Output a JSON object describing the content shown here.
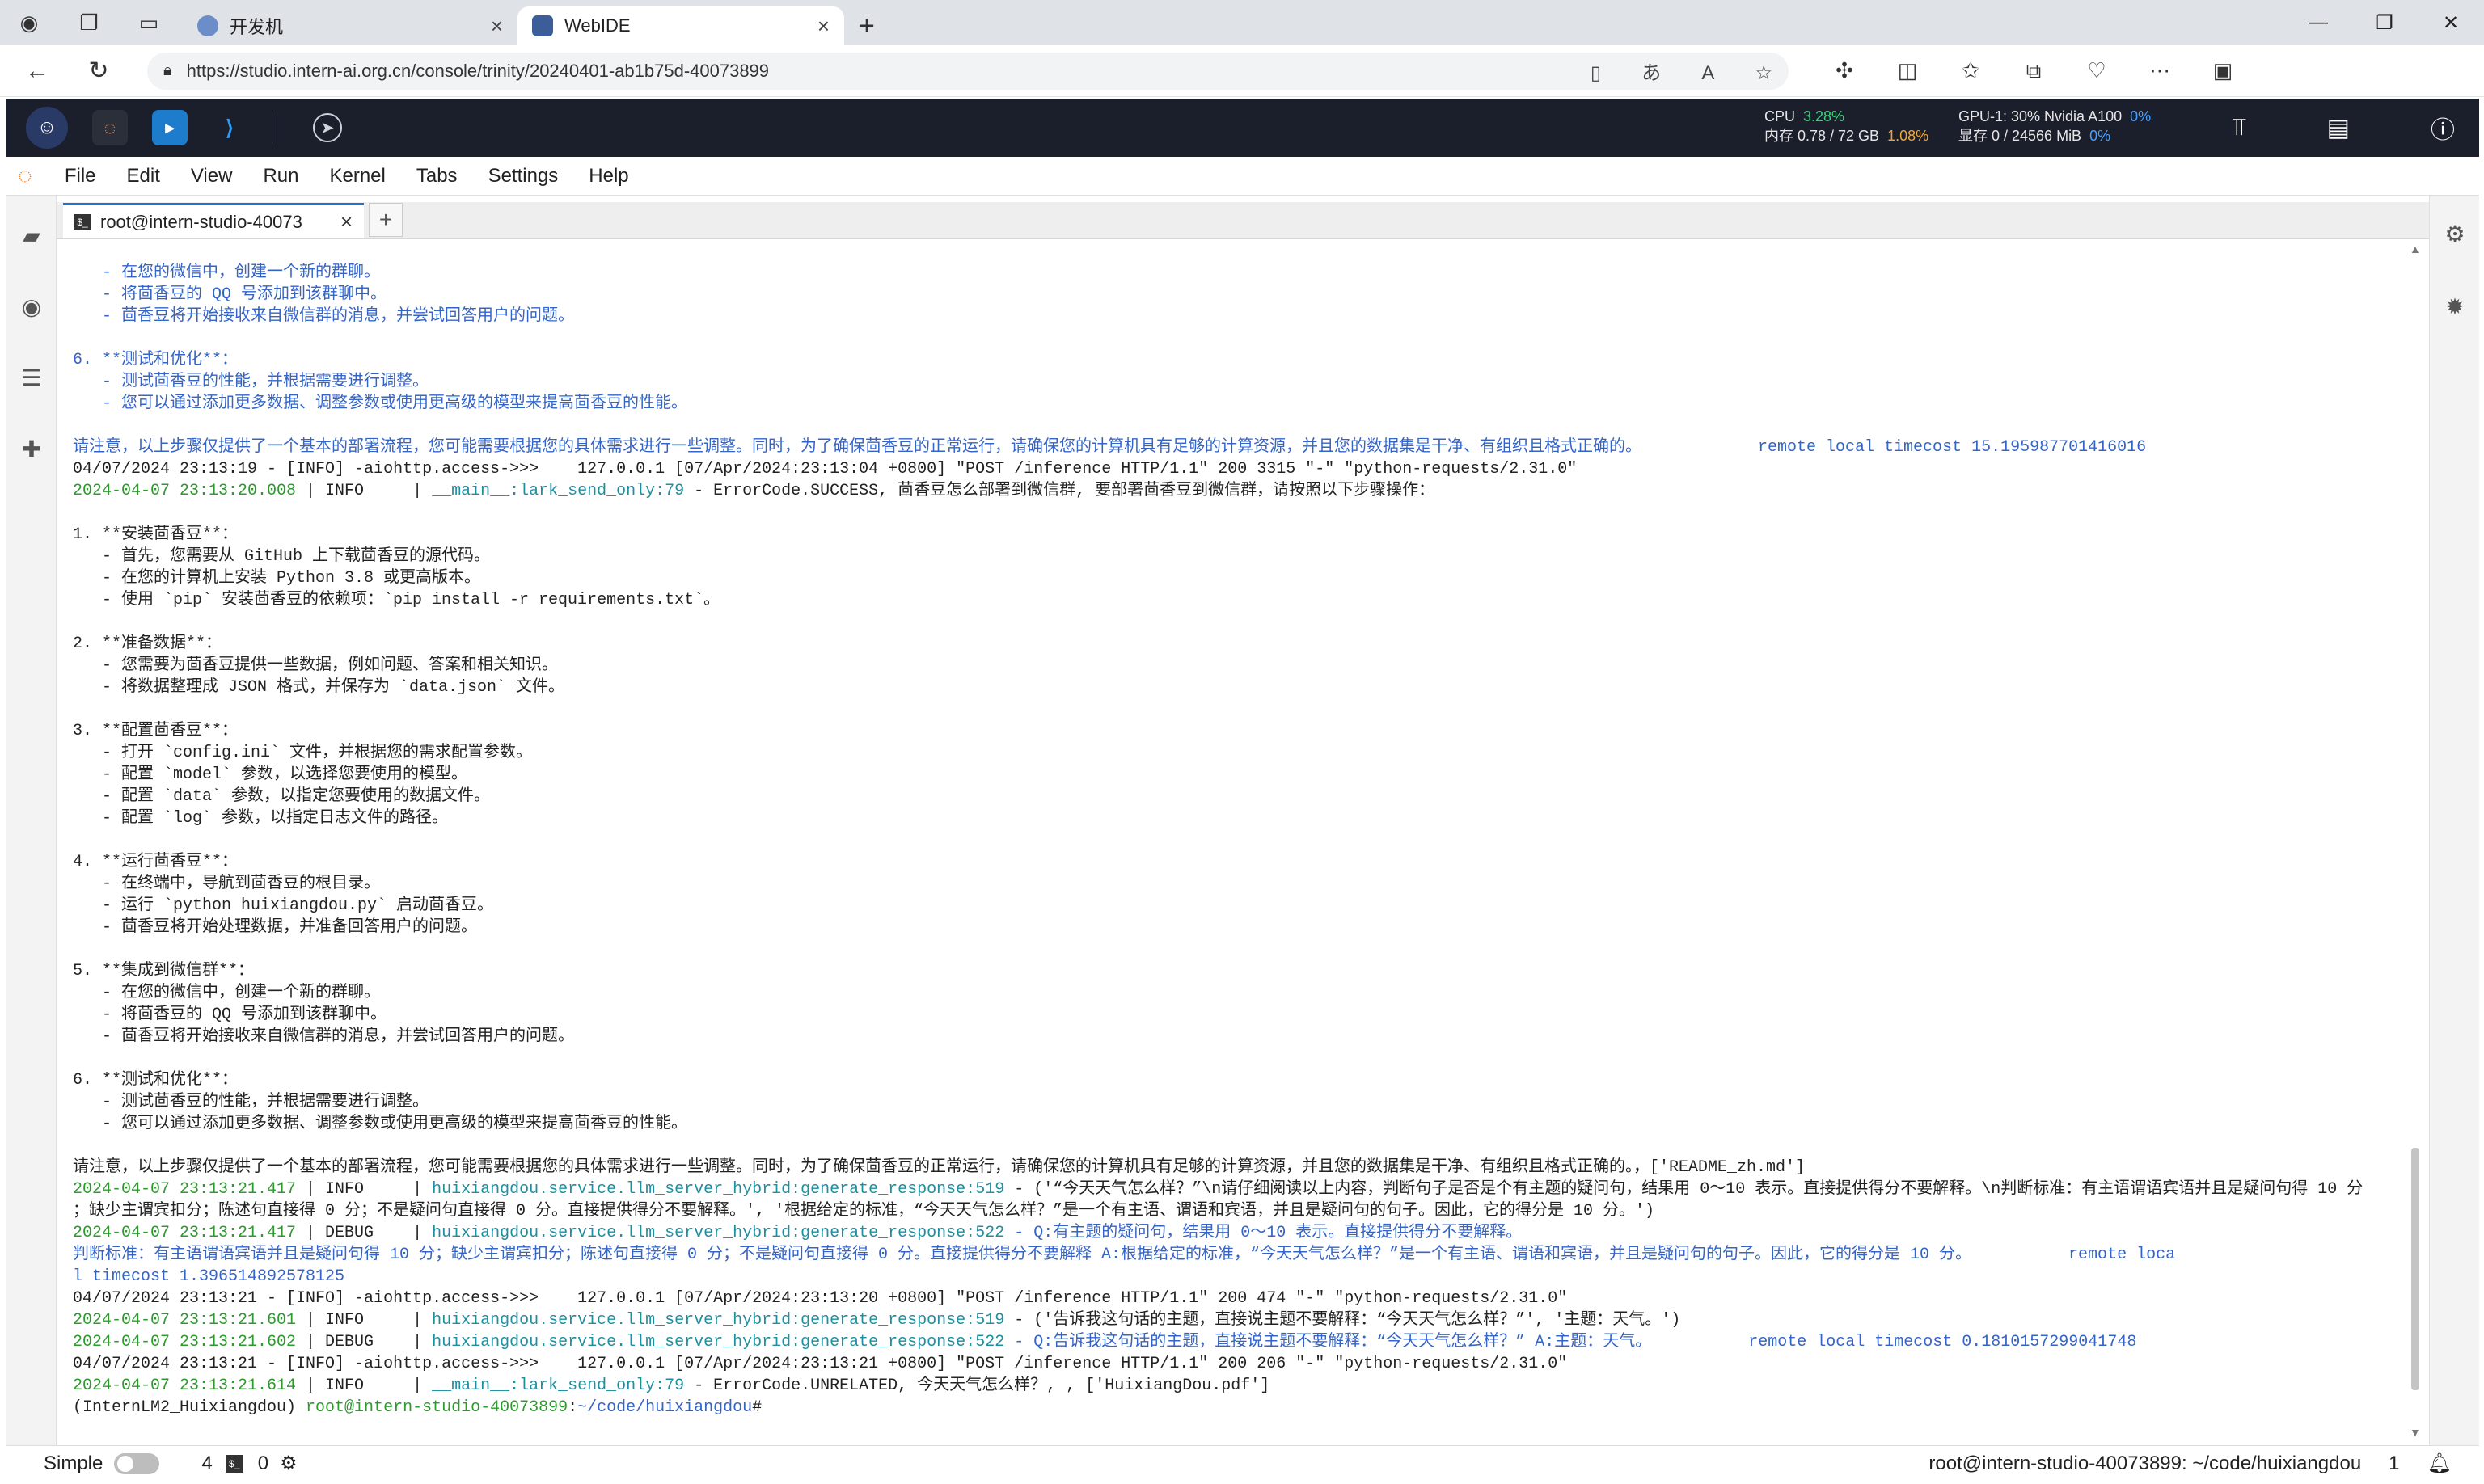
{
  "browser": {
    "tabs": [
      {
        "title": "开发机",
        "active": false
      },
      {
        "title": "WebIDE",
        "active": true
      }
    ],
    "url": "https://studio.intern-ai.org.cn/console/trinity/20240401-ab1b75d-40073899"
  },
  "ide": {
    "stats": {
      "cpu_label": "CPU",
      "cpu_value": "3.28%",
      "mem_label": "内存 0.78 / 72 GB",
      "mem_value": "1.08%",
      "gpu_label": "GPU-1: 30% Nvidia A100",
      "gpu_value": "0%",
      "vram_label": "显存 0 / 24566 MiB",
      "vram_value": "0%"
    }
  },
  "menu": [
    "File",
    "Edit",
    "View",
    "Run",
    "Kernel",
    "Tabs",
    "Settings",
    "Help"
  ],
  "terminal_tab": {
    "label": "root@intern-studio-40073"
  },
  "terminal_lines": [
    {
      "cls": "blue",
      "parts": [
        {
          "c": "",
          "t": "   - 在您的微信中，创建一个新的群聊。"
        }
      ]
    },
    {
      "cls": "blue",
      "parts": [
        {
          "c": "",
          "t": "   - 将茴香豆的 QQ 号添加到该群聊中。"
        }
      ]
    },
    {
      "cls": "blue",
      "parts": [
        {
          "c": "",
          "t": "   - 茴香豆将开始接收来自微信群的消息，并尝试回答用户的问题。"
        }
      ]
    },
    {
      "cls": "blue",
      "parts": [
        {
          "c": "",
          "t": ""
        }
      ]
    },
    {
      "cls": "blue",
      "parts": [
        {
          "c": "",
          "t": "6. **测试和优化**："
        }
      ]
    },
    {
      "cls": "blue",
      "parts": [
        {
          "c": "",
          "t": "   - 测试茴香豆的性能，并根据需要进行调整。"
        }
      ]
    },
    {
      "cls": "blue",
      "parts": [
        {
          "c": "",
          "t": "   - 您可以通过添加更多数据、调整参数或使用更高级的模型来提高茴香豆的性能。"
        }
      ]
    },
    {
      "cls": "blue",
      "parts": [
        {
          "c": "",
          "t": ""
        }
      ]
    },
    {
      "cls": "blue",
      "parts": [
        {
          "c": "",
          "t": "请注意，以上步骤仅提供了一个基本的部署流程，您可能需要根据您的具体需求进行一些调整。同时，为了确保茴香豆的正常运行，请确保您的计算机具有足够的计算资源，并且您的数据集是干净、有组织且格式正确的。            remote local timecost 15.195987701416016"
        }
      ]
    },
    {
      "cls": "",
      "parts": [
        {
          "c": "k",
          "t": "04/07/2024 23:13:19 - [INFO] -aiohttp.access->>>    127.0.0.1 [07/Apr/2024:23:13:04 +0800] \"POST /inference HTTP/1.1\" 200 3315 \"-\" \"python-requests/2.31.0\""
        }
      ]
    },
    {
      "cls": "",
      "parts": [
        {
          "c": "g",
          "t": "2024-04-07 23:13:20.008"
        },
        {
          "c": "k",
          "t": " | INFO     | "
        },
        {
          "c": "t",
          "t": "__main__:lark_send_only:79"
        },
        {
          "c": "k",
          "t": " - ErrorCode.SUCCESS, 茴香豆怎么部署到微信群, 要部署茴香豆到微信群，请按照以下步骤操作："
        }
      ]
    },
    {
      "cls": "",
      "parts": [
        {
          "c": "k",
          "t": ""
        }
      ]
    },
    {
      "cls": "",
      "parts": [
        {
          "c": "k",
          "t": "1. **安装茴香豆**："
        }
      ]
    },
    {
      "cls": "",
      "parts": [
        {
          "c": "k",
          "t": "   - 首先，您需要从 GitHub 上下载茴香豆的源代码。"
        }
      ]
    },
    {
      "cls": "",
      "parts": [
        {
          "c": "k",
          "t": "   - 在您的计算机上安装 Python 3.8 或更高版本。"
        }
      ]
    },
    {
      "cls": "",
      "parts": [
        {
          "c": "k",
          "t": "   - 使用 `pip` 安装茴香豆的依赖项：`pip install -r requirements.txt`。"
        }
      ]
    },
    {
      "cls": "",
      "parts": [
        {
          "c": "k",
          "t": ""
        }
      ]
    },
    {
      "cls": "",
      "parts": [
        {
          "c": "k",
          "t": "2. **准备数据**："
        }
      ]
    },
    {
      "cls": "",
      "parts": [
        {
          "c": "k",
          "t": "   - 您需要为茴香豆提供一些数据，例如问题、答案和相关知识。"
        }
      ]
    },
    {
      "cls": "",
      "parts": [
        {
          "c": "k",
          "t": "   - 将数据整理成 JSON 格式，并保存为 `data.json` 文件。"
        }
      ]
    },
    {
      "cls": "",
      "parts": [
        {
          "c": "k",
          "t": ""
        }
      ]
    },
    {
      "cls": "",
      "parts": [
        {
          "c": "k",
          "t": "3. **配置茴香豆**："
        }
      ]
    },
    {
      "cls": "",
      "parts": [
        {
          "c": "k",
          "t": "   - 打开 `config.ini` 文件，并根据您的需求配置参数。"
        }
      ]
    },
    {
      "cls": "",
      "parts": [
        {
          "c": "k",
          "t": "   - 配置 `model` 参数，以选择您要使用的模型。"
        }
      ]
    },
    {
      "cls": "",
      "parts": [
        {
          "c": "k",
          "t": "   - 配置 `data` 参数，以指定您要使用的数据文件。"
        }
      ]
    },
    {
      "cls": "",
      "parts": [
        {
          "c": "k",
          "t": "   - 配置 `log` 参数，以指定日志文件的路径。"
        }
      ]
    },
    {
      "cls": "",
      "parts": [
        {
          "c": "k",
          "t": ""
        }
      ]
    },
    {
      "cls": "",
      "parts": [
        {
          "c": "k",
          "t": "4. **运行茴香豆**："
        }
      ]
    },
    {
      "cls": "",
      "parts": [
        {
          "c": "k",
          "t": "   - 在终端中，导航到茴香豆的根目录。"
        }
      ]
    },
    {
      "cls": "",
      "parts": [
        {
          "c": "k",
          "t": "   - 运行 `python huixiangdou.py` 启动茴香豆。"
        }
      ]
    },
    {
      "cls": "",
      "parts": [
        {
          "c": "k",
          "t": "   - 茴香豆将开始处理数据，并准备回答用户的问题。"
        }
      ]
    },
    {
      "cls": "",
      "parts": [
        {
          "c": "k",
          "t": ""
        }
      ]
    },
    {
      "cls": "",
      "parts": [
        {
          "c": "k",
          "t": "5. **集成到微信群**："
        }
      ]
    },
    {
      "cls": "",
      "parts": [
        {
          "c": "k",
          "t": "   - 在您的微信中，创建一个新的群聊。"
        }
      ]
    },
    {
      "cls": "",
      "parts": [
        {
          "c": "k",
          "t": "   - 将茴香豆的 QQ 号添加到该群聊中。"
        }
      ]
    },
    {
      "cls": "",
      "parts": [
        {
          "c": "k",
          "t": "   - 茴香豆将开始接收来自微信群的消息，并尝试回答用户的问题。"
        }
      ]
    },
    {
      "cls": "",
      "parts": [
        {
          "c": "k",
          "t": ""
        }
      ]
    },
    {
      "cls": "",
      "parts": [
        {
          "c": "k",
          "t": "6. **测试和优化**："
        }
      ]
    },
    {
      "cls": "",
      "parts": [
        {
          "c": "k",
          "t": "   - 测试茴香豆的性能，并根据需要进行调整。"
        }
      ]
    },
    {
      "cls": "",
      "parts": [
        {
          "c": "k",
          "t": "   - 您可以通过添加更多数据、调整参数或使用更高级的模型来提高茴香豆的性能。"
        }
      ]
    },
    {
      "cls": "",
      "parts": [
        {
          "c": "k",
          "t": ""
        }
      ]
    },
    {
      "cls": "",
      "parts": [
        {
          "c": "k",
          "t": "请注意，以上步骤仅提供了一个基本的部署流程，您可能需要根据您的具体需求进行一些调整。同时，为了确保茴香豆的正常运行，请确保您的计算机具有足够的计算资源，并且您的数据集是干净、有组织且格式正确的。，['README_zh.md']"
        }
      ]
    },
    {
      "cls": "",
      "parts": [
        {
          "c": "g",
          "t": "2024-04-07 23:13:21.417"
        },
        {
          "c": "k",
          "t": " | INFO     | "
        },
        {
          "c": "t",
          "t": "huixiangdou.service.llm_server_hybrid:generate_response:519"
        },
        {
          "c": "k",
          "t": " - ('“今天天气怎么样？”\\n请仔细阅读以上内容，判断句子是否是个有主题的疑问句，结果用 0～10 表示。直接提供得分不要解释。\\n判断标准：有主语谓语宾语并且是疑问句得 10 分"
        }
      ]
    },
    {
      "cls": "",
      "parts": [
        {
          "c": "k",
          "t": "；缺少主谓宾扣分；陈述句直接得 0 分；不是疑问句直接得 0 分。直接提供得分不要解释。', '根据给定的标准，“今天天气怎么样？”是一个有主语、谓语和宾语，并且是疑问句的句子。因此，它的得分是 10 分。')"
        }
      ]
    },
    {
      "cls": "",
      "parts": [
        {
          "c": "g",
          "t": "2024-04-07 23:13:21.417"
        },
        {
          "c": "k",
          "t": " | DEBUG    | "
        },
        {
          "c": "t",
          "t": "huixiangdou.service.llm_server_hybrid:generate_response:522"
        },
        {
          "c": "b",
          "t": " - Q:有主题的疑问句，结果用 0～10 表示。直接提供得分不要解释。"
        }
      ]
    },
    {
      "cls": "blue",
      "parts": [
        {
          "c": "",
          "t": "判断标准：有主语谓语宾语并且是疑问句得 10 分；缺少主谓宾扣分；陈述句直接得 0 分；不是疑问句直接得 0 分。直接提供得分不要解释 A:根据给定的标准，“今天天气怎么样？”是一个有主语、谓语和宾语，并且是疑问句的句子。因此，它的得分是 10 分。          remote loca"
        }
      ]
    },
    {
      "cls": "blue",
      "parts": [
        {
          "c": "",
          "t": "l timecost 1.396514892578125"
        }
      ]
    },
    {
      "cls": "",
      "parts": [
        {
          "c": "k",
          "t": "04/07/2024 23:13:21 - [INFO] -aiohttp.access->>>    127.0.0.1 [07/Apr/2024:23:13:20 +0800] \"POST /inference HTTP/1.1\" 200 474 \"-\" \"python-requests/2.31.0\""
        }
      ]
    },
    {
      "cls": "",
      "parts": [
        {
          "c": "g",
          "t": "2024-04-07 23:13:21.601"
        },
        {
          "c": "k",
          "t": " | INFO     | "
        },
        {
          "c": "t",
          "t": "huixiangdou.service.llm_server_hybrid:generate_response:519"
        },
        {
          "c": "k",
          "t": " - ('告诉我这句话的主题，直接说主题不要解释：“今天天气怎么样？”', '主题：天气。')"
        }
      ]
    },
    {
      "cls": "",
      "parts": [
        {
          "c": "g",
          "t": "2024-04-07 23:13:21.602"
        },
        {
          "c": "k",
          "t": " | DEBUG    | "
        },
        {
          "c": "t",
          "t": "huixiangdou.service.llm_server_hybrid:generate_response:522"
        },
        {
          "c": "b",
          "t": " - Q:告诉我这句话的主题，直接说主题不要解释：“今天天气怎么样？” A:主题：天气。          remote local timecost 0.1810157299041748"
        }
      ]
    },
    {
      "cls": "",
      "parts": [
        {
          "c": "k",
          "t": "04/07/2024 23:13:21 - [INFO] -aiohttp.access->>>    127.0.0.1 [07/Apr/2024:23:13:21 +0800] \"POST /inference HTTP/1.1\" 200 206 \"-\" \"python-requests/2.31.0\""
        }
      ]
    },
    {
      "cls": "",
      "parts": [
        {
          "c": "g",
          "t": "2024-04-07 23:13:21.614"
        },
        {
          "c": "k",
          "t": " | INFO     | "
        },
        {
          "c": "t",
          "t": "__main__:lark_send_only:79"
        },
        {
          "c": "k",
          "t": " - ErrorCode.UNRELATED, 今天天气怎么样？, , ['HuixiangDou.pdf']"
        }
      ]
    },
    {
      "cls": "",
      "parts": [
        {
          "c": "k",
          "t": "(InternLM2_Huixiangdou) "
        },
        {
          "c": "g",
          "t": "root@intern-studio-40073899"
        },
        {
          "c": "k",
          "t": ":"
        },
        {
          "c": "b",
          "t": "~/code/huixiangdou"
        },
        {
          "c": "k",
          "t": "#"
        }
      ]
    }
  ],
  "statusbar": {
    "mode_label": "Simple",
    "count_a": "4",
    "count_b": "0",
    "right_text": "root@intern-studio-40073899: ~/code/huixiangdou",
    "right_num": "1"
  },
  "colors": {
    "accent": "#1976d2",
    "ide_bar": "#1b1f2b",
    "term_blue": "#3564c7",
    "term_green": "#2e9a2e"
  }
}
